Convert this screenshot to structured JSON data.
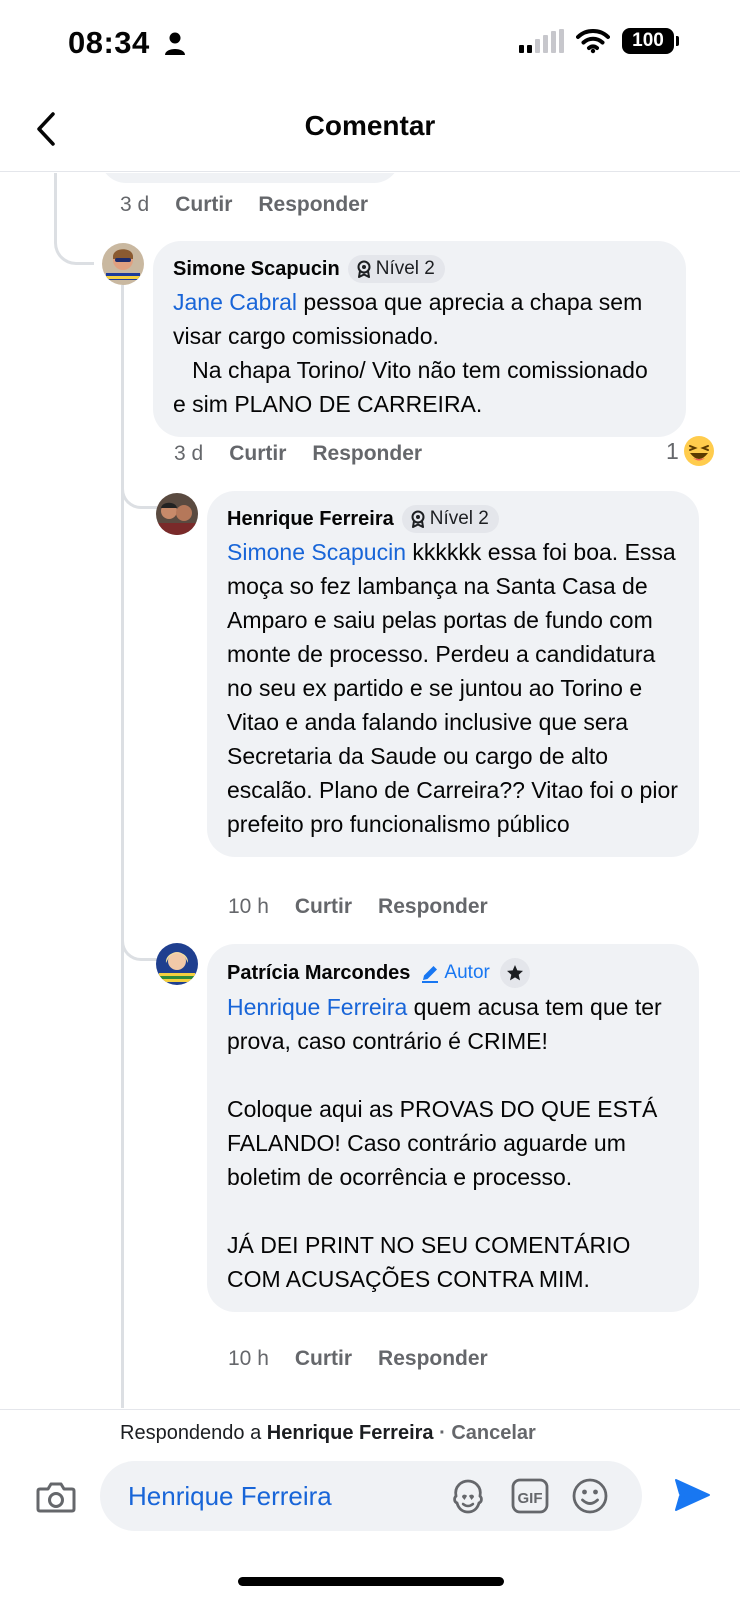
{
  "status_bar": {
    "time": "08:34",
    "battery": "100"
  },
  "header": {
    "title": "Comentar",
    "back_icon": "chevron-left-icon"
  },
  "comments": [
    {
      "meta": {
        "time": "3 d",
        "like": "Curtir",
        "reply": "Responder"
      }
    },
    {
      "author": "Simone Scapucin",
      "badge": "Nível 2",
      "mention": "Jane Cabral",
      "text": " pessoa que aprecia a chapa sem visar cargo comissionado.\n   Na chapa Torino/ Vito não tem comissionado e sim PLANO DE CARREIRA.",
      "meta": {
        "time": "3 d",
        "like": "Curtir",
        "reply": "Responder"
      },
      "reaction_count": "1",
      "reaction_icon": "laughing-emoji-icon"
    },
    {
      "author": "Henrique Ferreira",
      "badge": "Nível 2",
      "mention": "Simone Scapucin",
      "text": " kkkkkk essa foi boa. Essa moça so fez lambança na Santa Casa de Amparo e saiu pelas portas de fundo com monte de processo. Perdeu a candidatura no seu ex partido e se juntou ao Torino e Vitao e anda falando inclusive que sera Secretaria da Saude ou cargo de alto escalão. Plano de Carreira?? Vitao foi o pior prefeito pro funcionalismo público",
      "meta": {
        "time": "10 h",
        "like": "Curtir",
        "reply": "Responder"
      }
    },
    {
      "author": "Patrícia Marcondes",
      "badge": "Autor",
      "mention": "Henrique Ferreira",
      "text": " quem acusa tem que ter prova, caso contrário é CRIME!\n\nColoque aqui as PROVAS DO QUE ESTÁ FALANDO! Caso contrário aguarde um boletim de ocorrência e processo.\n\nJÁ DEI PRINT NO SEU COMENTÁRIO COM ACUSAÇÕES CONTRA MIM.",
      "meta": {
        "time": "10 h",
        "like": "Curtir",
        "reply": "Responder"
      }
    }
  ],
  "reply_banner": {
    "prefix": "Respondendo a ",
    "name": "Henrique Ferreira",
    "separator": " · ",
    "cancel": "Cancelar"
  },
  "composer": {
    "value": "Henrique Ferreira",
    "icons": [
      "camera-icon",
      "avatar-sticker-icon",
      "gif-icon",
      "emoji-icon",
      "send-icon"
    ]
  },
  "colors": {
    "accent": "#1877f2",
    "mention": "#1865d8",
    "bubble": "#f0f2f5",
    "muted": "#65676b"
  }
}
